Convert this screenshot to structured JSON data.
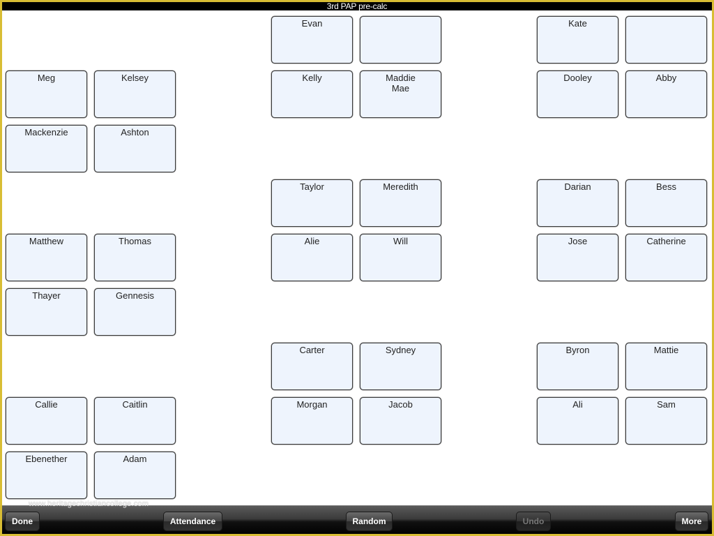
{
  "window": {
    "title": "3rd PAP pre-calc"
  },
  "seats": [
    {
      "name": "Meg"
    },
    {
      "name": "Kelsey"
    },
    {
      "name": "Mackenzie"
    },
    {
      "name": "Ashton"
    },
    {
      "name": "Matthew"
    },
    {
      "name": "Thomas"
    },
    {
      "name": "Thayer"
    },
    {
      "name": "Gennesis"
    },
    {
      "name": "Callie"
    },
    {
      "name": "Caitlin"
    },
    {
      "name": "Ebenether"
    },
    {
      "name": "Adam"
    },
    {
      "name": "Evan"
    },
    {
      "name": ""
    },
    {
      "name": "Kelly"
    },
    {
      "name": "Maddie\nMae"
    },
    {
      "name": "Taylor"
    },
    {
      "name": "Meredith"
    },
    {
      "name": "Alie"
    },
    {
      "name": "Will"
    },
    {
      "name": "Carter"
    },
    {
      "name": "Sydney"
    },
    {
      "name": "Morgan"
    },
    {
      "name": "Jacob"
    },
    {
      "name": "Kate"
    },
    {
      "name": ""
    },
    {
      "name": "Dooley"
    },
    {
      "name": "Abby"
    },
    {
      "name": "Darian"
    },
    {
      "name": "Bess"
    },
    {
      "name": "Jose"
    },
    {
      "name": "Catherine"
    },
    {
      "name": "Byron"
    },
    {
      "name": "Mattie"
    },
    {
      "name": "Ali"
    },
    {
      "name": "Sam"
    }
  ],
  "watermark": "www.heritagechristiancollege.com",
  "toolbar": {
    "done_label": "Done",
    "attendance_label": "Attendance",
    "random_label": "Random",
    "undo_label": "Undo",
    "undo_enabled": false,
    "more_label": "More"
  },
  "colors": {
    "frame_border": "#d8bd34",
    "seat_fill": "#eef4fd",
    "title_bar": "#000000"
  }
}
